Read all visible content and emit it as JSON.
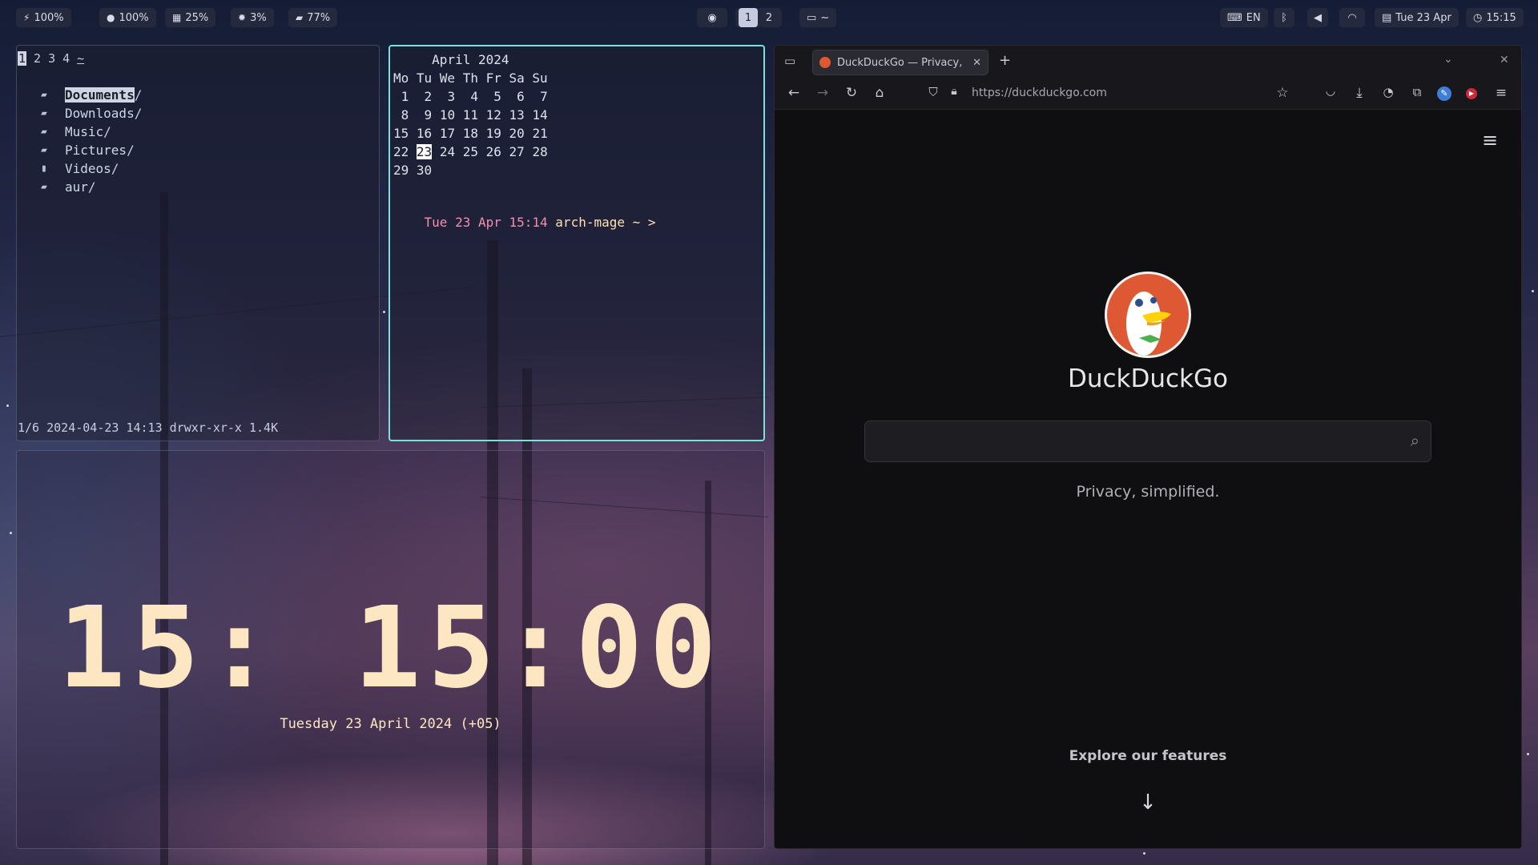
{
  "topbar": {
    "stats": [
      {
        "icon": "bolt-icon",
        "glyph": "⚡",
        "value": "100%"
      },
      {
        "icon": "circle-icon",
        "glyph": "●",
        "value": "100%"
      },
      {
        "icon": "memory-icon",
        "glyph": "▦",
        "value": "25%"
      },
      {
        "icon": "cpu-icon",
        "glyph": "✹",
        "value": "3%"
      },
      {
        "icon": "folder-icon",
        "glyph": "▰",
        "value": "77%"
      }
    ],
    "workspaces": [
      "1",
      "2"
    ],
    "window_label": "~",
    "keyboard_layout": "EN",
    "date": "Tue 23 Apr",
    "time": "15:15"
  },
  "file_manager": {
    "tabs": [
      "1",
      "2",
      "3",
      "4",
      "~"
    ],
    "items": [
      {
        "name": "Documents",
        "suffix": "/"
      },
      {
        "name": "Downloads",
        "suffix": "/"
      },
      {
        "name": "Music",
        "suffix": "/"
      },
      {
        "name": "Pictures",
        "suffix": "/"
      },
      {
        "name": "Videos",
        "suffix": "/"
      },
      {
        "name": "aur",
        "suffix": "/"
      }
    ],
    "status": "1/6 2024-04-23 14:13 drwxr-xr-x 1.4K"
  },
  "terminal": {
    "cal_title": "     April 2024",
    "cal_header": "Mo Tu We Th Fr Sa Su",
    "cal_rows": [
      [
        " 1",
        " 2",
        " 3",
        " 4",
        " 5",
        " 6",
        " 7"
      ],
      [
        " 8",
        " 9",
        "10",
        "11",
        "12",
        "13",
        "14"
      ],
      [
        "15",
        "16",
        "17",
        "18",
        "19",
        "20",
        "21"
      ],
      [
        "22",
        "23",
        "24",
        "25",
        "26",
        "27",
        "28"
      ],
      [
        "29",
        "30"
      ]
    ],
    "today": "23",
    "prompt_time": "Tue 23 Apr 15:14",
    "prompt_host": "arch-mage ~ >"
  },
  "clock": {
    "time": "15: 15:00",
    "date": "Tuesday 23 April 2024 (+05)"
  },
  "browser": {
    "tab_title": "DuckDuckGo — Privacy, simplified.",
    "url": "https://duckduckgo.com",
    "brand": "DuckDuckGo",
    "tagline": "Privacy, simplified.",
    "explore": "Explore our features",
    "colors": {
      "accent": "#de5833",
      "bg": "#0f0f11"
    }
  }
}
